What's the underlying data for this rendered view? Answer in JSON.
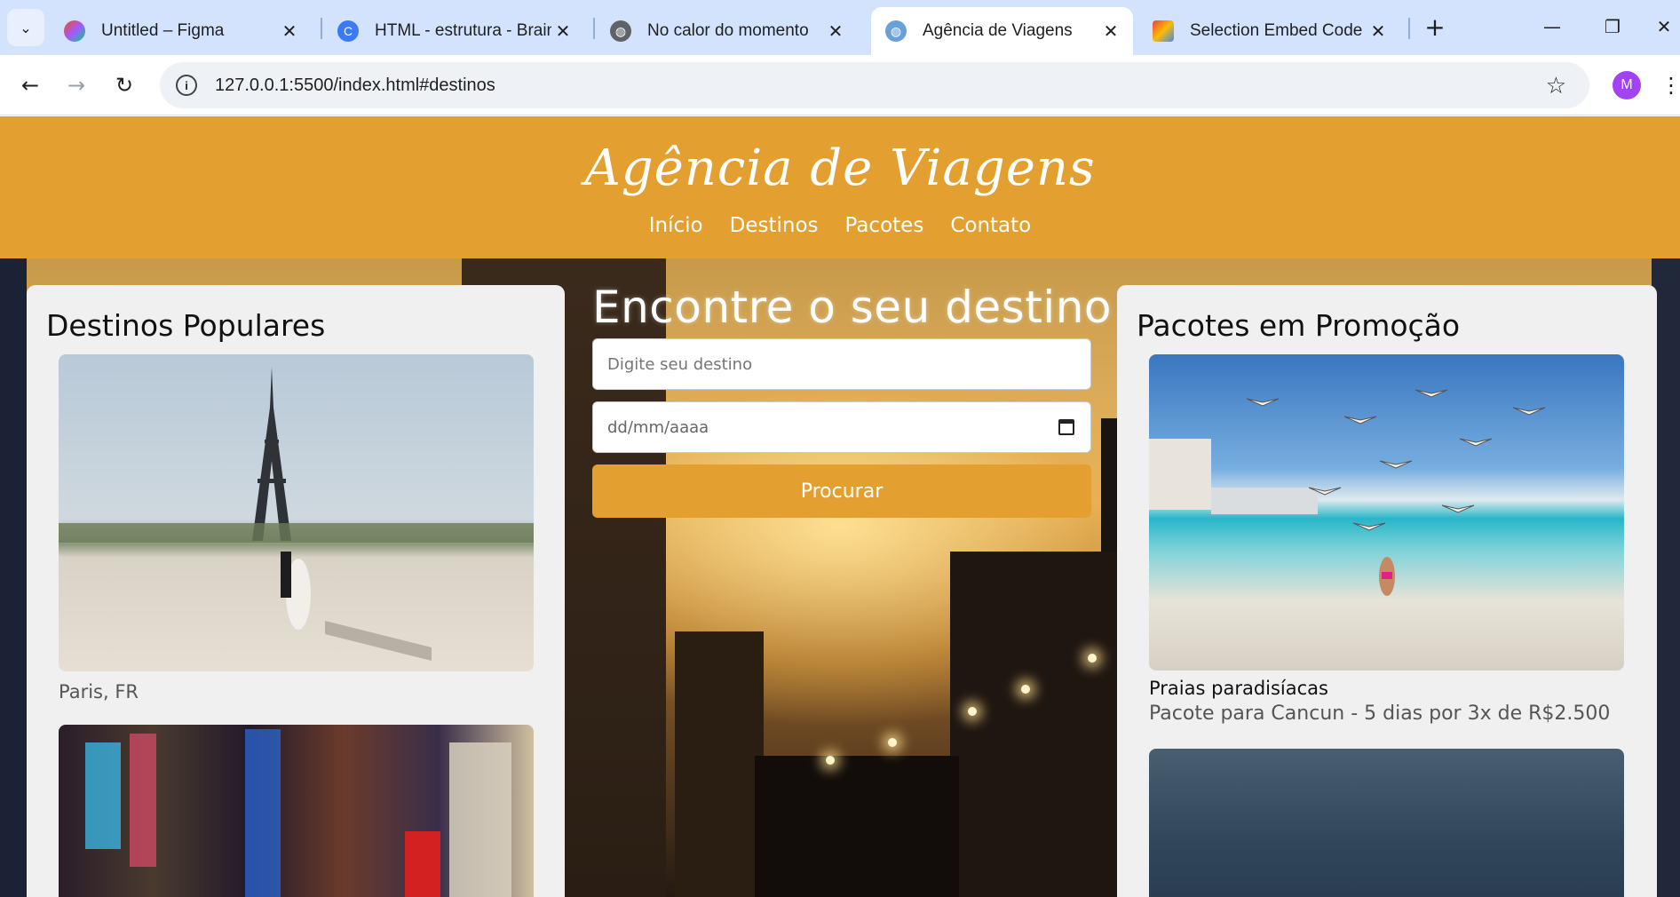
{
  "browser": {
    "tabs": [
      {
        "title": "Untitled – Figma",
        "active": false,
        "icon": "figma-icon"
      },
      {
        "title": "HTML - estrutura - Brains",
        "active": false,
        "icon": "brainstorm-icon"
      },
      {
        "title": "No calor do momento",
        "active": false,
        "icon": "globe-icon"
      },
      {
        "title": "Agência de Viagens",
        "active": true,
        "icon": "globe-icon"
      },
      {
        "title": "Selection Embed Code - ",
        "active": false,
        "icon": "embed-icon"
      }
    ],
    "url": "127.0.0.1:5500/index.html#destinos",
    "profile_initial": "M"
  },
  "site": {
    "title": "Agência de Viagens",
    "nav": [
      "Início",
      "Destinos",
      "Pacotes",
      "Contato"
    ]
  },
  "popular": {
    "heading": "Destinos Populares",
    "items": [
      {
        "caption": "Paris, FR"
      },
      {
        "caption": ""
      }
    ]
  },
  "search": {
    "title": "Encontre o seu destino",
    "destination_placeholder": "Digite seu destino",
    "date_placeholder": "dd/mm/aaaa",
    "button_label": "Procurar"
  },
  "promo": {
    "heading": "Pacotes em Promoção",
    "items": [
      {
        "title": "Praias paradisíacas",
        "description": "Pacote para Cancun - 5 dias por 3x de R$2.500"
      }
    ]
  },
  "colors": {
    "accent": "#e3a030",
    "panel_bg": "#f0f0f0",
    "browser_tabstrip": "#d3e3fd"
  }
}
